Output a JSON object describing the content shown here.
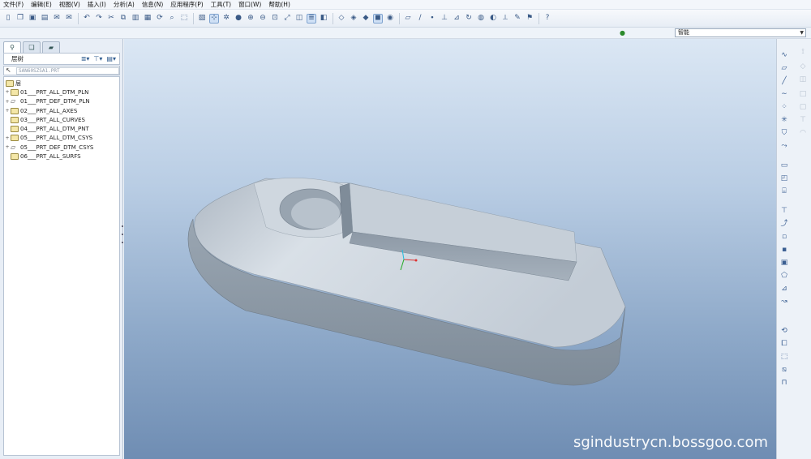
{
  "menu": [
    "文件(F)",
    "编辑(E)",
    "视图(V)",
    "插入(I)",
    "分析(A)",
    "信息(N)",
    "应用程序(P)",
    "工具(T)",
    "窗口(W)",
    "帮助(H)"
  ],
  "toolbar": {
    "groups": [
      [
        "new-icon",
        "open-icon",
        "save-icon",
        "print-icon",
        "send-icon",
        "send-icon"
      ],
      [
        "undo-icon",
        "redo-icon",
        "cut-icon",
        "copy-icon",
        "paste-icon",
        "paste-special-icon",
        "regenerate-icon",
        "find-icon",
        "selection-box-icon"
      ],
      [
        "repaint-icon",
        "spin-center-icon",
        "orient-icon",
        "display-style-icon",
        "zoom-in-icon",
        "zoom-out-icon",
        "refit-icon",
        "reorient-icon",
        "saved-views-icon",
        "layers-icon",
        "appearance-icon"
      ],
      [
        "wireframe-icon",
        "hidden-line-icon",
        "no-hidden-icon",
        "shading-icon",
        "enhanced-realism-icon"
      ],
      [
        "datum-plane-icon",
        "datum-axis-icon",
        "datum-point-icon",
        "coordinate-system-icon",
        "annotations-icon",
        "spin-icon",
        "texture-icon",
        "color-icon",
        "measure-icon",
        "sketch-icon",
        "annotation-icon"
      ],
      [
        "context-help-icon"
      ]
    ]
  },
  "icon_glyphs": {
    "new-icon": "▯",
    "open-icon": "❐",
    "save-icon": "▣",
    "print-icon": "▤",
    "send-icon": "✉",
    "undo-icon": "↶",
    "redo-icon": "↷",
    "cut-icon": "✂",
    "copy-icon": "⧉",
    "paste-icon": "▥",
    "paste-special-icon": "▦",
    "regenerate-icon": "⟳",
    "find-icon": "⌕",
    "selection-box-icon": "⬚",
    "repaint-icon": "▧",
    "spin-center-icon": "⊹",
    "orient-icon": "✲",
    "display-style-icon": "●",
    "zoom-in-icon": "⊕",
    "zoom-out-icon": "⊖",
    "refit-icon": "⊡",
    "reorient-icon": "⤢",
    "saved-views-icon": "◫",
    "layers-icon": "≣",
    "appearance-icon": "◧",
    "wireframe-icon": "◇",
    "hidden-line-icon": "◈",
    "no-hidden-icon": "◆",
    "shading-icon": "◼",
    "enhanced-realism-icon": "◉",
    "datum-plane-icon": "▱",
    "datum-axis-icon": "∕",
    "datum-point-icon": "∙",
    "coordinate-system-icon": "⊥",
    "annotations-icon": "⊿",
    "spin-icon": "↻",
    "texture-icon": "◍",
    "color-icon": "◐",
    "measure-icon": "⟂",
    "sketch-icon": "✎",
    "annotation-icon": "⚑",
    "context-help-icon": "?",
    "filter-light-icon": "●",
    "layer-tab-icon": "⚲",
    "model-tree-tab-icon": "❏",
    "folder-tab-icon": "▰",
    "layer-display-icon": "≣",
    "show-icon": "⊤",
    "settings-icon": "▤",
    "pointer-icon": "↖",
    "expand-icon": "+",
    "plane-icon": "▱"
  },
  "filter": {
    "label": "智能"
  },
  "left_panel": {
    "tabs": [
      "layer-tab-icon",
      "model-tree-tab-icon",
      "folder-tab-icon"
    ],
    "header_label": "层树",
    "path_value": "SAN60SZSA1.PRT",
    "root_label": "层",
    "layers": [
      {
        "label": "01___PRT_ALL_DTM_PLN",
        "expandable": true,
        "icon": "layer"
      },
      {
        "label": "01___PRT_DEF_DTM_PLN",
        "expandable": true,
        "icon": "plane"
      },
      {
        "label": "02___PRT_ALL_AXES",
        "expandable": true,
        "icon": "layer"
      },
      {
        "label": "03___PRT_ALL_CURVES",
        "expandable": false,
        "icon": "layer"
      },
      {
        "label": "04___PRT_ALL_DTM_PNT",
        "expandable": false,
        "icon": "layer"
      },
      {
        "label": "05___PRT_ALL_DTM_CSYS",
        "expandable": true,
        "icon": "layer"
      },
      {
        "label": "05___PRT_DEF_DTM_CSYS",
        "expandable": true,
        "icon": "plane"
      },
      {
        "label": "06___PRT_ALL_SURFS",
        "expandable": false,
        "icon": "layer"
      }
    ]
  },
  "viewport": {
    "watermark": "sgindustrycn.bossgoo.com"
  },
  "right_toolbar": {
    "col1": [
      "sketch-icon",
      "datum-plane-icon",
      "datum-axis-icon",
      "curve-icon",
      "datum-point-icon",
      "csys-icon",
      "analysis-icon",
      "blend-icon",
      "extrude-icon",
      "revolve-icon",
      "variable-sweep-icon",
      "hole-icon",
      "shell-icon",
      "rib-icon",
      "draft-icon",
      "round-icon",
      "chamfer-icon",
      "boundary-icon",
      "style-icon",
      "mirror-icon",
      "merge-icon",
      "trim-icon",
      "offset-icon",
      "thicken-icon"
    ],
    "col2": [
      "dim-datum-icon",
      "dim-axis-icon",
      "dim-plane-icon",
      "dim-box-icon",
      "dim-rect-icon",
      "dim-text-icon",
      "dim-sheet-icon"
    ],
    "glyphs": {
      "sketch-icon": "∿",
      "datum-plane-icon": "▱",
      "datum-axis-icon": "╱",
      "curve-icon": "∼",
      "datum-point-icon": "⁘",
      "csys-icon": "✳",
      "analysis-icon": "⛉",
      "blend-icon": "⤳",
      "extrude-icon": "▭",
      "revolve-icon": "◰",
      "variable-sweep-icon": "⌸",
      "hole-icon": "⊤",
      "shell-icon": "⤴",
      "rib-icon": "▫",
      "draft-icon": "▪",
      "round-icon": "▣",
      "chamfer-icon": "⬠",
      "boundary-icon": "⊿",
      "style-icon": "↝",
      "mirror-icon": "⟲",
      "merge-icon": "⧠",
      "trim-icon": "⬚",
      "offset-icon": "⧅",
      "thicken-icon": "⊓",
      "dim-datum-icon": "⟟",
      "dim-axis-icon": "◇",
      "dim-plane-icon": "◫",
      "dim-box-icon": "□",
      "dim-rect-icon": "▢",
      "dim-text-icon": "⊤",
      "dim-sheet-icon": "◠"
    }
  },
  "colors": {
    "part_top": "#c9d2dc",
    "part_side": "#8f9ca8",
    "part_edge": "#aeb9c4",
    "background_top": "#dbe7f4",
    "background_bottom": "#6f8db3"
  }
}
